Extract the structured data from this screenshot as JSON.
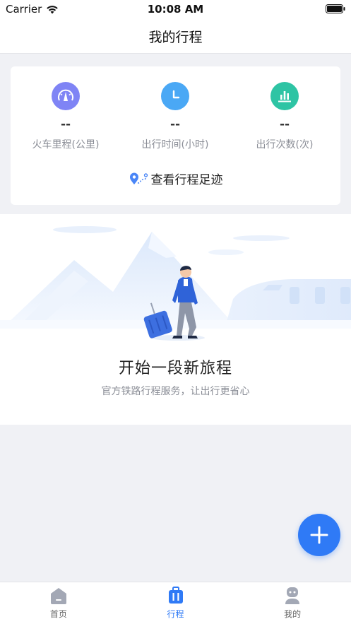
{
  "status_bar": {
    "carrier": "Carrier",
    "time": "10:08 AM"
  },
  "nav": {
    "title": "我的行程"
  },
  "stats": {
    "items": [
      {
        "value": "--",
        "label": "火车里程(公里)",
        "icon": "speedometer-icon",
        "color": "#7f84f5"
      },
      {
        "value": "--",
        "label": "出行时间(小时)",
        "icon": "clock-icon",
        "color": "#4aa8f5"
      },
      {
        "value": "--",
        "label": "出行次数(次)",
        "icon": "bar-chart-icon",
        "color": "#2ec4a4"
      }
    ],
    "footprint_label": "查看行程足迹"
  },
  "empty_state": {
    "title": "开始一段新旅程",
    "subtitle": "官方铁路行程服务，让出行更省心"
  },
  "fab": {
    "icon": "plus-icon"
  },
  "tabs": [
    {
      "label": "首页",
      "icon": "home-icon"
    },
    {
      "label": "行程",
      "icon": "luggage-icon",
      "active": true
    },
    {
      "label": "我的",
      "icon": "profile-icon"
    }
  ],
  "colors": {
    "accent": "#2f7af6",
    "background": "#f0f1f5"
  }
}
